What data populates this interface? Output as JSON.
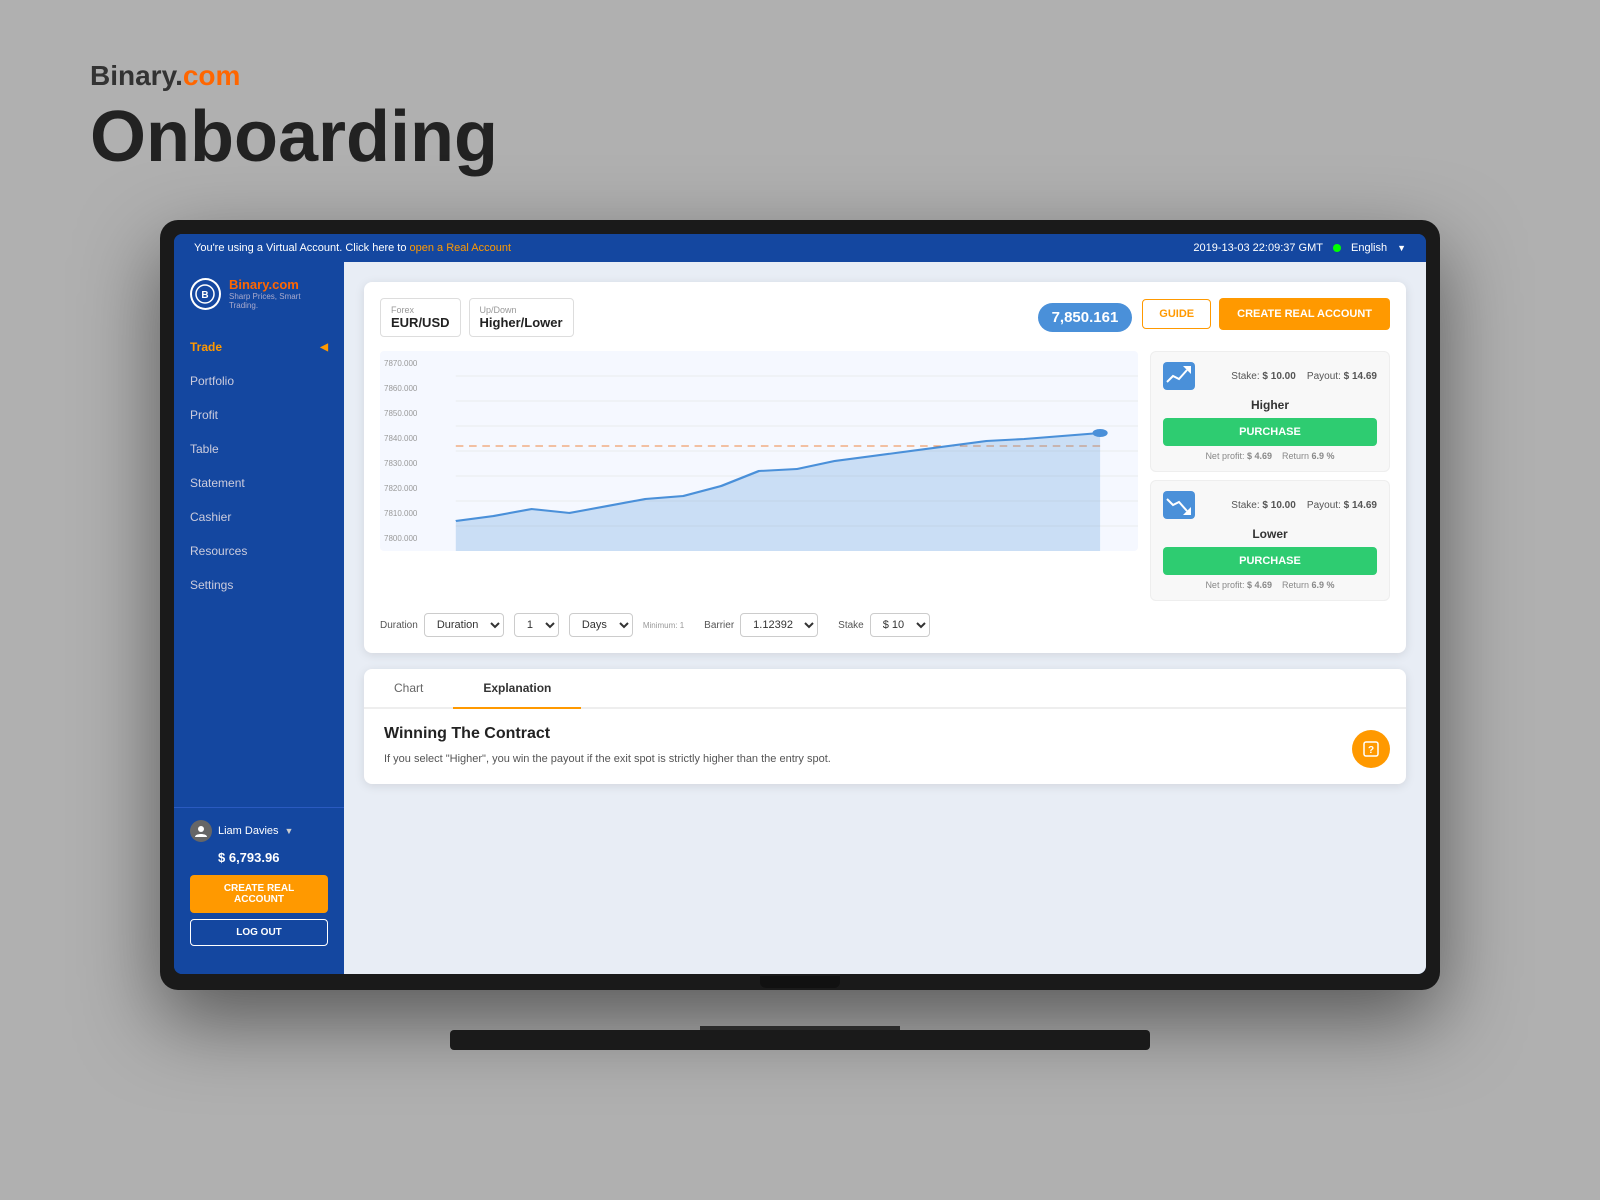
{
  "branding": {
    "binary": "Binary.",
    "com": "com",
    "title": "Onboarding"
  },
  "topbar": {
    "virtual_message": "You're using a Virtual Account. Click here to ",
    "real_account_link": "open a Real Account",
    "datetime": "2019-13-03 22:09:37 GMT",
    "language": "English"
  },
  "sidebar": {
    "logo_text": "Binary.",
    "logo_com": "com",
    "logo_sub1": "Sharp Prices, Smart Trading.",
    "nav_items": [
      {
        "label": "Trade",
        "active": true
      },
      {
        "label": "Portfolio",
        "active": false
      },
      {
        "label": "Profit",
        "active": false
      },
      {
        "label": "Table",
        "active": false
      },
      {
        "label": "Statement",
        "active": false
      },
      {
        "label": "Cashier",
        "active": false
      },
      {
        "label": "Resources",
        "active": false
      },
      {
        "label": "Settings",
        "active": false
      }
    ],
    "user_name": "Liam Davies",
    "user_balance": "$ 6,793.96",
    "create_real_label": "CREATE REAL ACCOUNT",
    "logout_label": "LOG OUT"
  },
  "trade": {
    "forex_label": "Forex",
    "forex_value": "EUR/USD",
    "updown_label": "Up/Down",
    "updown_value": "Higher/Lower",
    "price": "7,850.161",
    "guide_btn": "GUIDE",
    "create_real_btn": "CREATE REAL ACCOUNT",
    "higher_option": {
      "label": "Higher",
      "stake_label": "Stake:",
      "stake_value": "$ 10.00",
      "payout_label": "Payout:",
      "payout_value": "$ 14.69",
      "purchase_btn": "PURCHASE",
      "net_profit_label": "Net profit:",
      "net_profit_value": "$ 4.69",
      "return_label": "Return",
      "return_value": "6.9 %"
    },
    "lower_option": {
      "label": "Lower",
      "stake_label": "Stake:",
      "stake_value": "$ 10.00",
      "payout_label": "Payout:",
      "payout_value": "$ 14.69",
      "purchase_btn": "PURCHASE",
      "net_profit_label": "Net profit:",
      "net_profit_value": "$ 4.69",
      "return_label": "Return",
      "return_value": "6.9 %"
    },
    "controls": {
      "duration_label": "Duration",
      "duration_value": "1",
      "duration_unit": "Days",
      "duration_minimum": "Minimum: 1",
      "barrier_label": "Barrier",
      "barrier_value": "1.12392",
      "stake_label": "Stake",
      "stake_value": "$ 10"
    },
    "chart_y_labels": [
      "7870.000",
      "7860.000",
      "7850.000",
      "7840.000",
      "7830.000",
      "7820.000",
      "7810.000",
      "7800.000"
    ]
  },
  "bottom": {
    "tabs": [
      {
        "label": "Chart",
        "active": false
      },
      {
        "label": "Explanation",
        "active": true
      }
    ],
    "contract_title": "Winning The Contract",
    "contract_desc": "If you select \"Higher\", you win the payout if the exit spot is strictly higher than the entry spot."
  }
}
